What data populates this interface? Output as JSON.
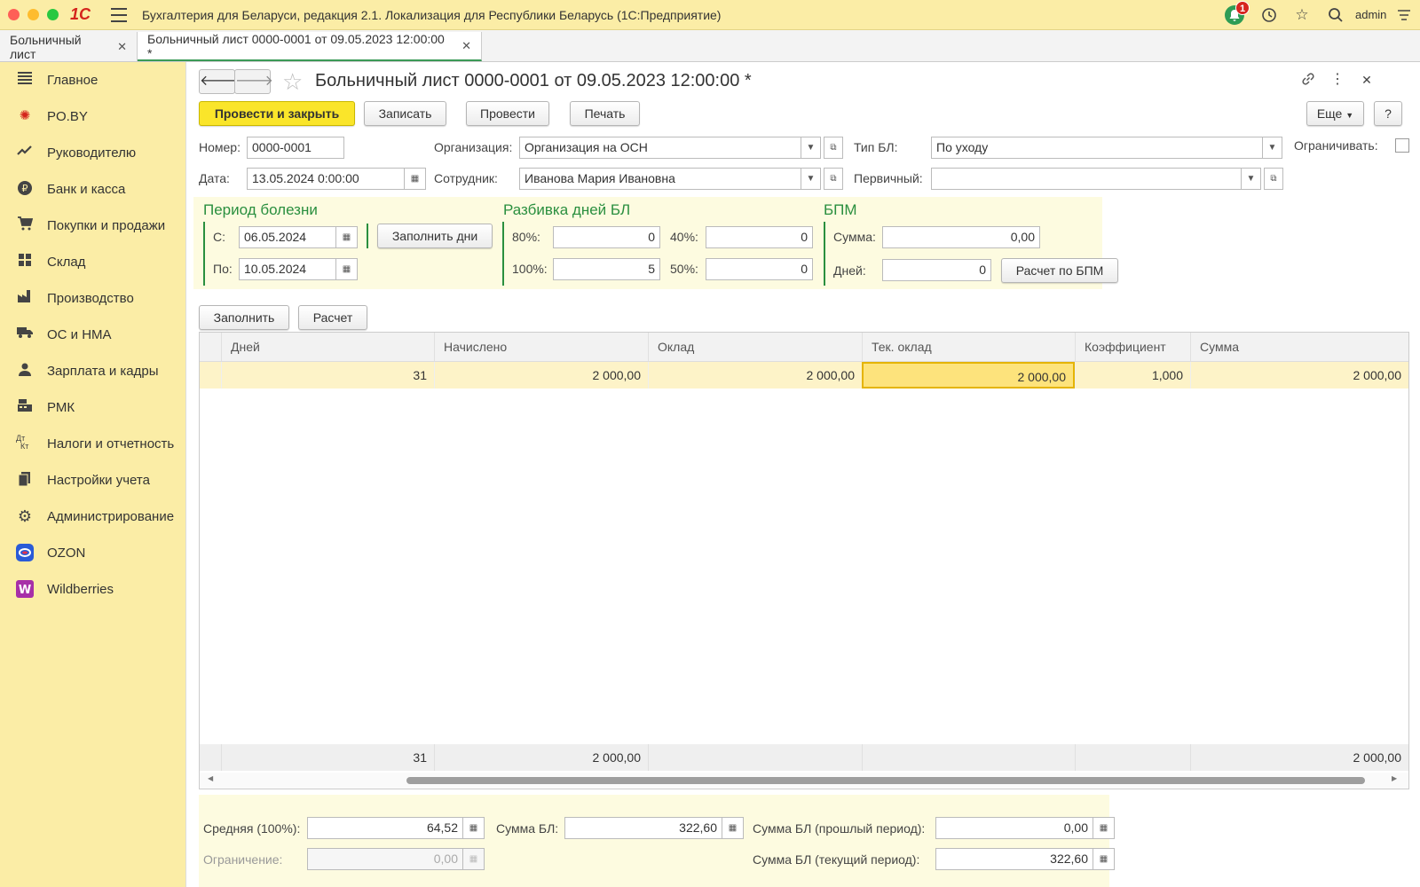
{
  "app": {
    "logo": "1С",
    "title": "Бухгалтерия для Беларуси, редакция 2.1. Локализация для Республики Беларусь   (1С:Предприятие)",
    "notification_count": "1",
    "username": "admin"
  },
  "tabs": [
    {
      "label": "Больничный лист"
    },
    {
      "label": "Больничный лист 0000-0001 от 09.05.2023 12:00:00 *"
    }
  ],
  "sidebar": {
    "items": [
      {
        "label": "Главное",
        "icon": "menu-lines-icon"
      },
      {
        "label": "PO.BY",
        "icon": "po-by-icon"
      },
      {
        "label": "Руководителю",
        "icon": "trend-icon"
      },
      {
        "label": "Банк и касса",
        "icon": "ruble-coin-icon"
      },
      {
        "label": "Покупки и продажи",
        "icon": "cart-icon"
      },
      {
        "label": "Склад",
        "icon": "warehouse-grid-icon"
      },
      {
        "label": "Производство",
        "icon": "factory-icon"
      },
      {
        "label": "ОС и НМА",
        "icon": "truck-icon"
      },
      {
        "label": "Зарплата и кадры",
        "icon": "person-icon"
      },
      {
        "label": "РМК",
        "icon": "cash-register-icon"
      },
      {
        "label": "Налоги и отчетность",
        "icon": "dt-kt-icon"
      },
      {
        "label": "Настройки учета",
        "icon": "documents-icon"
      },
      {
        "label": "Администрирование",
        "icon": "gear-icon"
      },
      {
        "label": "OZON",
        "icon": "ozon-logo-icon"
      },
      {
        "label": "Wildberries",
        "icon": "wildberries-logo-icon"
      }
    ],
    "ozon_color": "#2a5bd7",
    "wb_color": "#a72fa8"
  },
  "document": {
    "title": "Больничный лист 0000-0001 от 09.05.2023 12:00:00 *",
    "toolbar": {
      "post_close": "Провести и закрыть",
      "save": "Записать",
      "post": "Провести",
      "print": "Печать",
      "more": "Еще",
      "help": "?"
    },
    "header": {
      "number_label": "Номер:",
      "number_value": "0000-0001",
      "date_label": "Дата:",
      "date_value": "13.05.2024  0:00:00",
      "org_label": "Организация:",
      "org_value": "Организация на ОСН",
      "employee_label": "Сотрудник:",
      "employee_value": "Иванова Мария Ивановна",
      "type_label": "Тип БЛ:",
      "type_value": "По уходу",
      "primary_label": "Первичный:",
      "primary_value": "",
      "limit_label": "Ограничивать:"
    },
    "illness": {
      "title": "Период болезни",
      "from_label": "С:",
      "from_value": "06.05.2024",
      "to_label": "По:",
      "to_value": "10.05.2024",
      "fill_days": "Заполнить дни"
    },
    "split": {
      "title": "Разбивка дней БЛ",
      "p80_label": "80%:",
      "p80_value": "0",
      "p40_label": "40%:",
      "p40_value": "0",
      "p100_label": "100%:",
      "p100_value": "5",
      "p50_label": "50%:",
      "p50_value": "0"
    },
    "bpm": {
      "title": "БПМ",
      "sum_label": "Сумма:",
      "sum_value": "0,00",
      "days_label": "Дней:",
      "days_value": "0",
      "calc": "Расчет по БПМ"
    },
    "table_toolbar": {
      "fill": "Заполнить",
      "calc": "Расчет"
    },
    "table": {
      "columns": [
        "Дней",
        "Начислено",
        "Оклад",
        "Тек. оклад",
        "Коэффициент",
        "Сумма"
      ],
      "rows": [
        [
          "31",
          "2 000,00",
          "2 000,00",
          "2 000,00",
          "1,000",
          "2 000,00"
        ]
      ],
      "totals": [
        "31",
        "2 000,00",
        "",
        "",
        "",
        "2 000,00"
      ]
    },
    "footer": {
      "avg_label": "Средняя (100%):",
      "avg_value": "64,52",
      "limit_label": "Ограничение:",
      "limit_value": "0,00",
      "sum_label": "Сумма БЛ:",
      "sum_value": "322,60",
      "prev_label": "Сумма БЛ (прошлый период):",
      "prev_value": "0,00",
      "cur_label": "Сумма БЛ (текущий период):",
      "cur_value": "322,60"
    }
  }
}
